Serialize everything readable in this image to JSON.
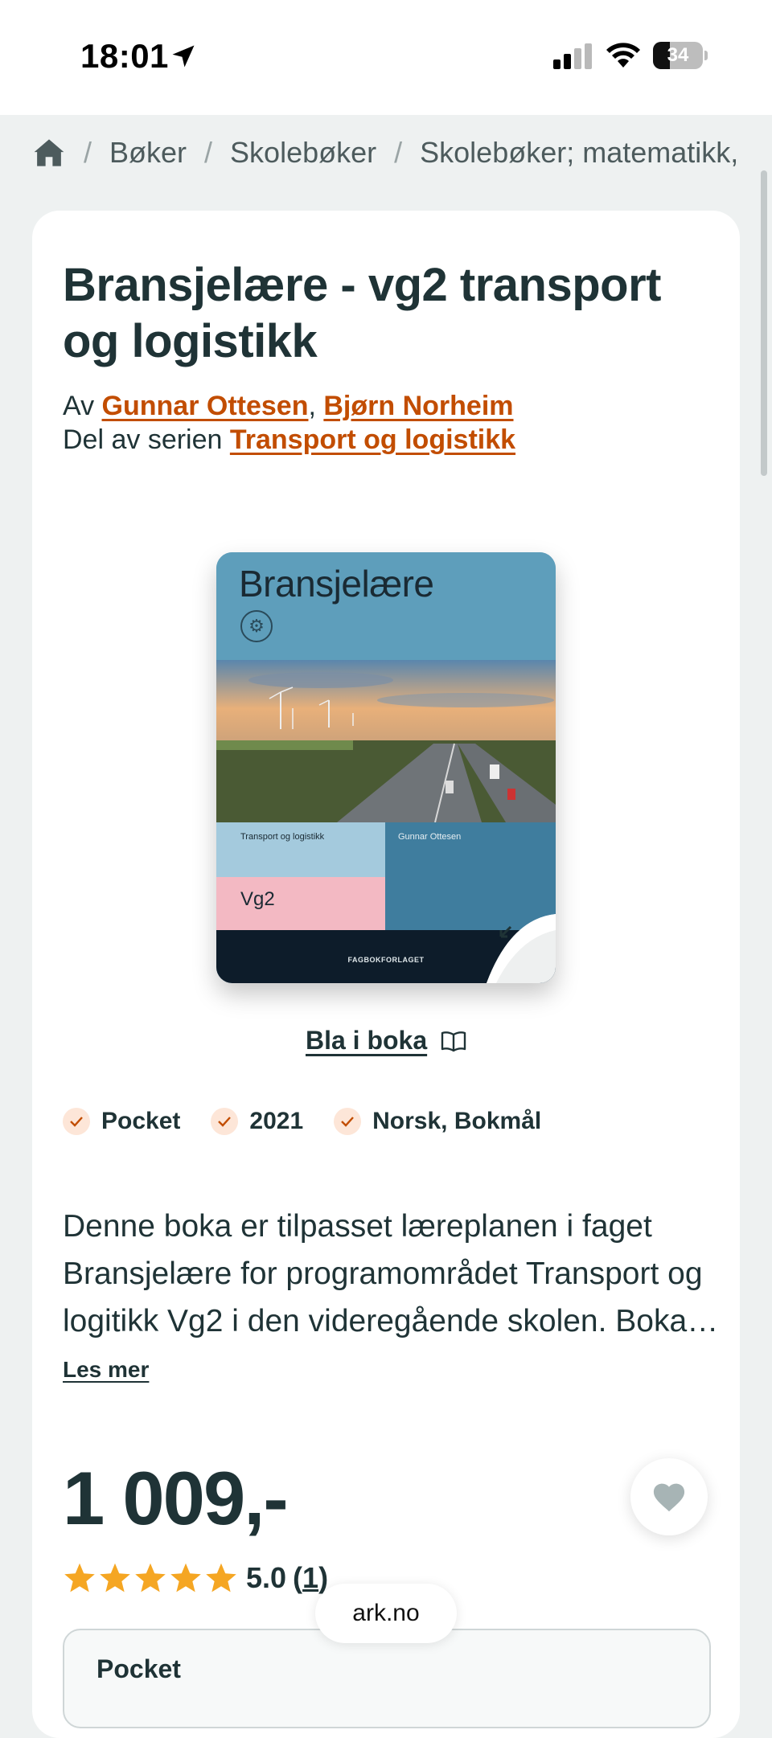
{
  "status_bar": {
    "time": "18:01",
    "battery": "34",
    "battery_level": 0.34
  },
  "breadcrumb": {
    "items": [
      "Bøker",
      "Skolebøker",
      "Skolebøker; matematikk,"
    ]
  },
  "product": {
    "title": "Bransjelære - vg2 transport og logistikk",
    "by_prefix": "Av",
    "authors": [
      "Gunnar Ottesen",
      "Bjørn Norheim"
    ],
    "author_separator": ",",
    "series_prefix": "Del av serien",
    "series": "Transport og logistikk",
    "cover": {
      "title": "Bransjelære",
      "series": "Transport og logistikk",
      "author": "Gunnar Ottesen",
      "level": "Vg2",
      "publisher": "FAGBOKFORLAGET"
    },
    "preview_label": "Bla i boka",
    "tags": [
      "Pocket",
      "2021",
      "Norsk, Bokmål"
    ],
    "description": "Denne boka er tilpasset læreplanen i faget Bransjelære for programområdet Transport og logitikk Vg2 i den videregående skolen. Boka gir en innføring i faget og dekker kompetansemålene i læreplanen.",
    "read_more": "Les mer",
    "price": "1 009,-",
    "rating": {
      "stars": 5,
      "score": "5.0",
      "count_open": "(",
      "count": "1",
      "count_close": ")"
    },
    "format_label": "Pocket"
  },
  "browser": {
    "url": "ark.no"
  },
  "colors": {
    "accent": "#c24d00",
    "text": "#1f3336",
    "star": "#f5a623",
    "check_bg": "#fde6d8"
  }
}
